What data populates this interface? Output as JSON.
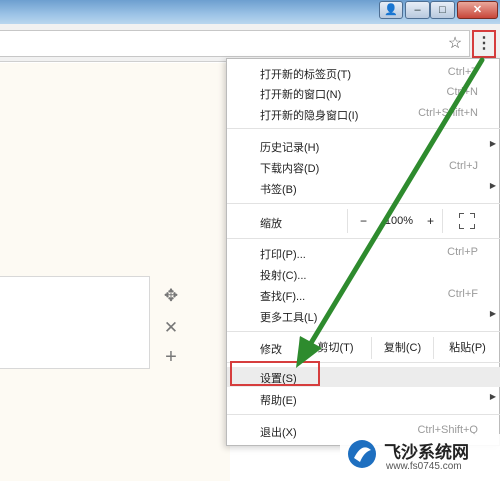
{
  "window": {
    "minimize_glyph": "–",
    "maximize_glyph": "□",
    "close_glyph": "✕",
    "user_glyph": "👤"
  },
  "toolbar": {
    "star_glyph": "☆",
    "menu_glyph": "⋮"
  },
  "side_icons": {
    "move_glyph": "✥",
    "remove_glyph": "✕",
    "add_glyph": "+"
  },
  "menu": {
    "new_tab": {
      "label": "打开新的标签页(T)",
      "shortcut": "Ctrl+T"
    },
    "new_window": {
      "label": "打开新的窗口(N)",
      "shortcut": "Ctrl+N"
    },
    "incognito": {
      "label": "打开新的隐身窗口(I)",
      "shortcut": "Ctrl+Shift+N"
    },
    "history": {
      "label": "历史记录(H)"
    },
    "downloads": {
      "label": "下载内容(D)",
      "shortcut": "Ctrl+J"
    },
    "bookmarks": {
      "label": "书签(B)"
    },
    "zoom": {
      "label": "缩放",
      "minus": "−",
      "value": "100%",
      "plus": "+"
    },
    "print": {
      "label": "打印(P)...",
      "shortcut": "Ctrl+P"
    },
    "cast": {
      "label": "投射(C)..."
    },
    "find": {
      "label": "查找(F)...",
      "shortcut": "Ctrl+F"
    },
    "more_tools": {
      "label": "更多工具(L)"
    },
    "edit": {
      "label": "修改",
      "cut": "剪切(T)",
      "copy": "复制(C)",
      "paste": "粘贴(P)"
    },
    "settings": {
      "label": "设置(S)"
    },
    "help": {
      "label": "帮助(E)"
    },
    "exit": {
      "label": "退出(X)",
      "shortcut": "Ctrl+Shift+Q"
    },
    "submenu_arrow": "▶"
  },
  "annotation": {
    "arrow_color": "#2e8b2e",
    "highlight_color": "#d63d3d"
  },
  "watermark": {
    "title": "飞沙系统网",
    "url": "www.fs0745.com"
  }
}
